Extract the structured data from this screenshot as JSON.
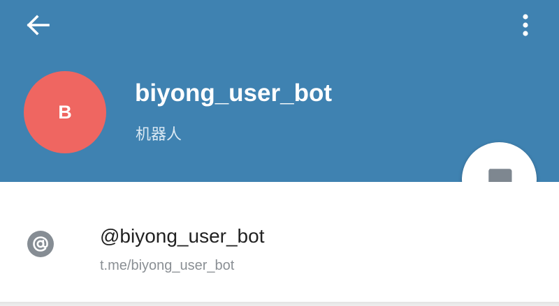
{
  "header": {
    "background_color": "#3f82b1",
    "back_icon": "arrow-left-icon",
    "menu_icon": "more-vertical-icon"
  },
  "profile": {
    "avatar_initial": "B",
    "avatar_color": "#ef6661",
    "name": "biyong_user_bot",
    "subtitle": "机器人"
  },
  "fab": {
    "icon": "message-icon",
    "icon_color": "#7e8790"
  },
  "info": {
    "icon": "at-sign-icon",
    "username": "@biyong_user_bot",
    "link": "t.me/biyong_user_bot"
  }
}
